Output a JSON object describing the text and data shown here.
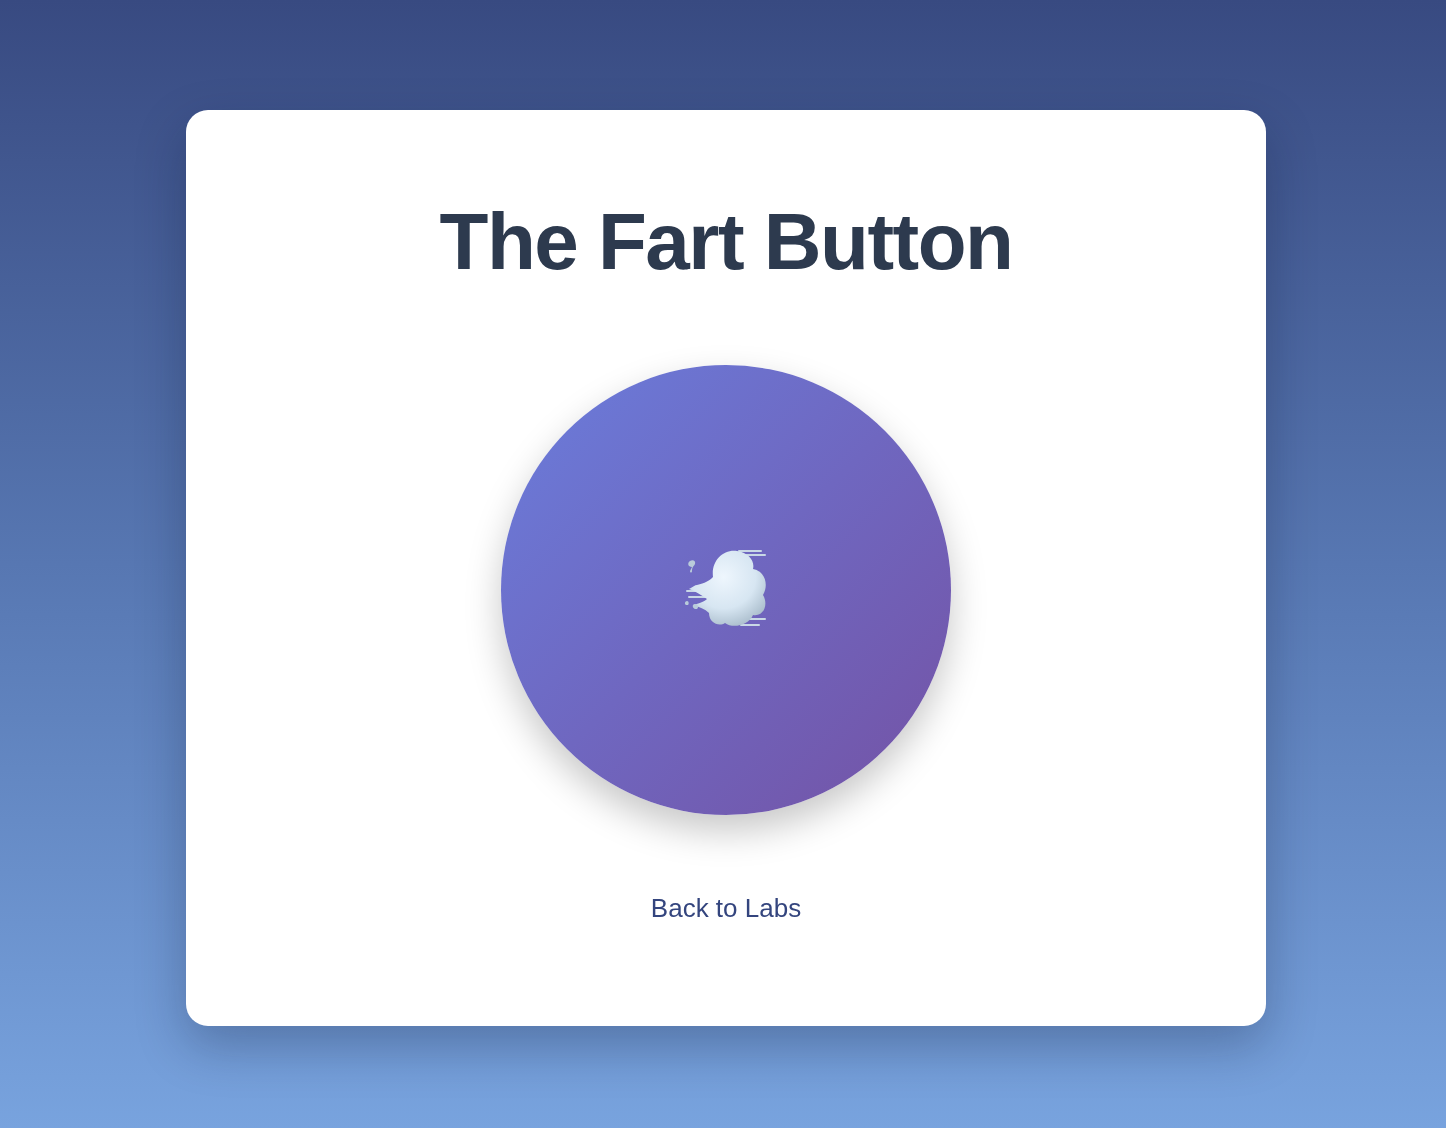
{
  "title": "The Fart Button",
  "back_link": {
    "label": "Back to Labs"
  }
}
